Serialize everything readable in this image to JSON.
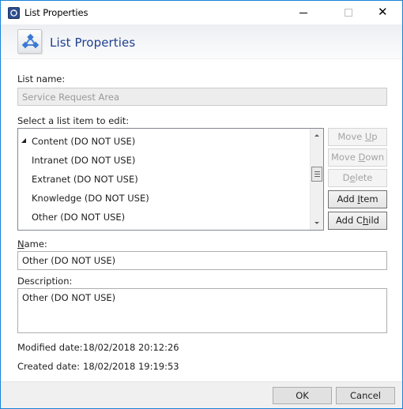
{
  "window": {
    "title": "List Properties",
    "app_icon": "app-logo-icon",
    "controls": {
      "minimize": "minimize-icon",
      "maximize": "maximize-icon",
      "close": "close-icon"
    }
  },
  "header": {
    "icon": "list-hierarchy-icon",
    "title": "List Properties"
  },
  "list_name": {
    "label": "List name:",
    "value": "Service Request Area",
    "disabled": true
  },
  "tree": {
    "label": "Select a list item to edit:",
    "items": [
      {
        "label": "Content (DO NOT USE)",
        "expanded": true,
        "level": 0
      },
      {
        "label": "Intranet (DO NOT USE)",
        "level": 1
      },
      {
        "label": "Extranet (DO NOT USE)",
        "level": 1
      },
      {
        "label": "Knowledge (DO NOT USE)",
        "level": 1
      },
      {
        "label": "Other (DO NOT USE)",
        "level": 1
      }
    ],
    "scroll_position": 0.3
  },
  "side_buttons": {
    "move_up": {
      "pre": "Move ",
      "accel": "U",
      "post": "p",
      "enabled": false
    },
    "move_down": {
      "pre": "Move ",
      "accel": "D",
      "post": "own",
      "enabled": false
    },
    "delete": {
      "pre": "D",
      "accel": "e",
      "post": "lete",
      "enabled": false
    },
    "add_item": {
      "pre": "Add ",
      "accel": "I",
      "post": "tem",
      "enabled": true
    },
    "add_child": {
      "pre": "Add C",
      "accel": "h",
      "post": "ild",
      "enabled": true
    }
  },
  "name": {
    "label_accel": "N",
    "label_rest": "ame:",
    "value": "Other (DO NOT USE)"
  },
  "description": {
    "label": "Description:",
    "value": "Other (DO NOT USE)"
  },
  "dates": {
    "modified_label": "Modified date:",
    "modified_value": "18/02/2018 20:12:26",
    "created_label": "Created date:",
    "created_value": "18/02/2018 19:19:53"
  },
  "footer": {
    "ok_label": "OK",
    "cancel_label": "Cancel"
  }
}
